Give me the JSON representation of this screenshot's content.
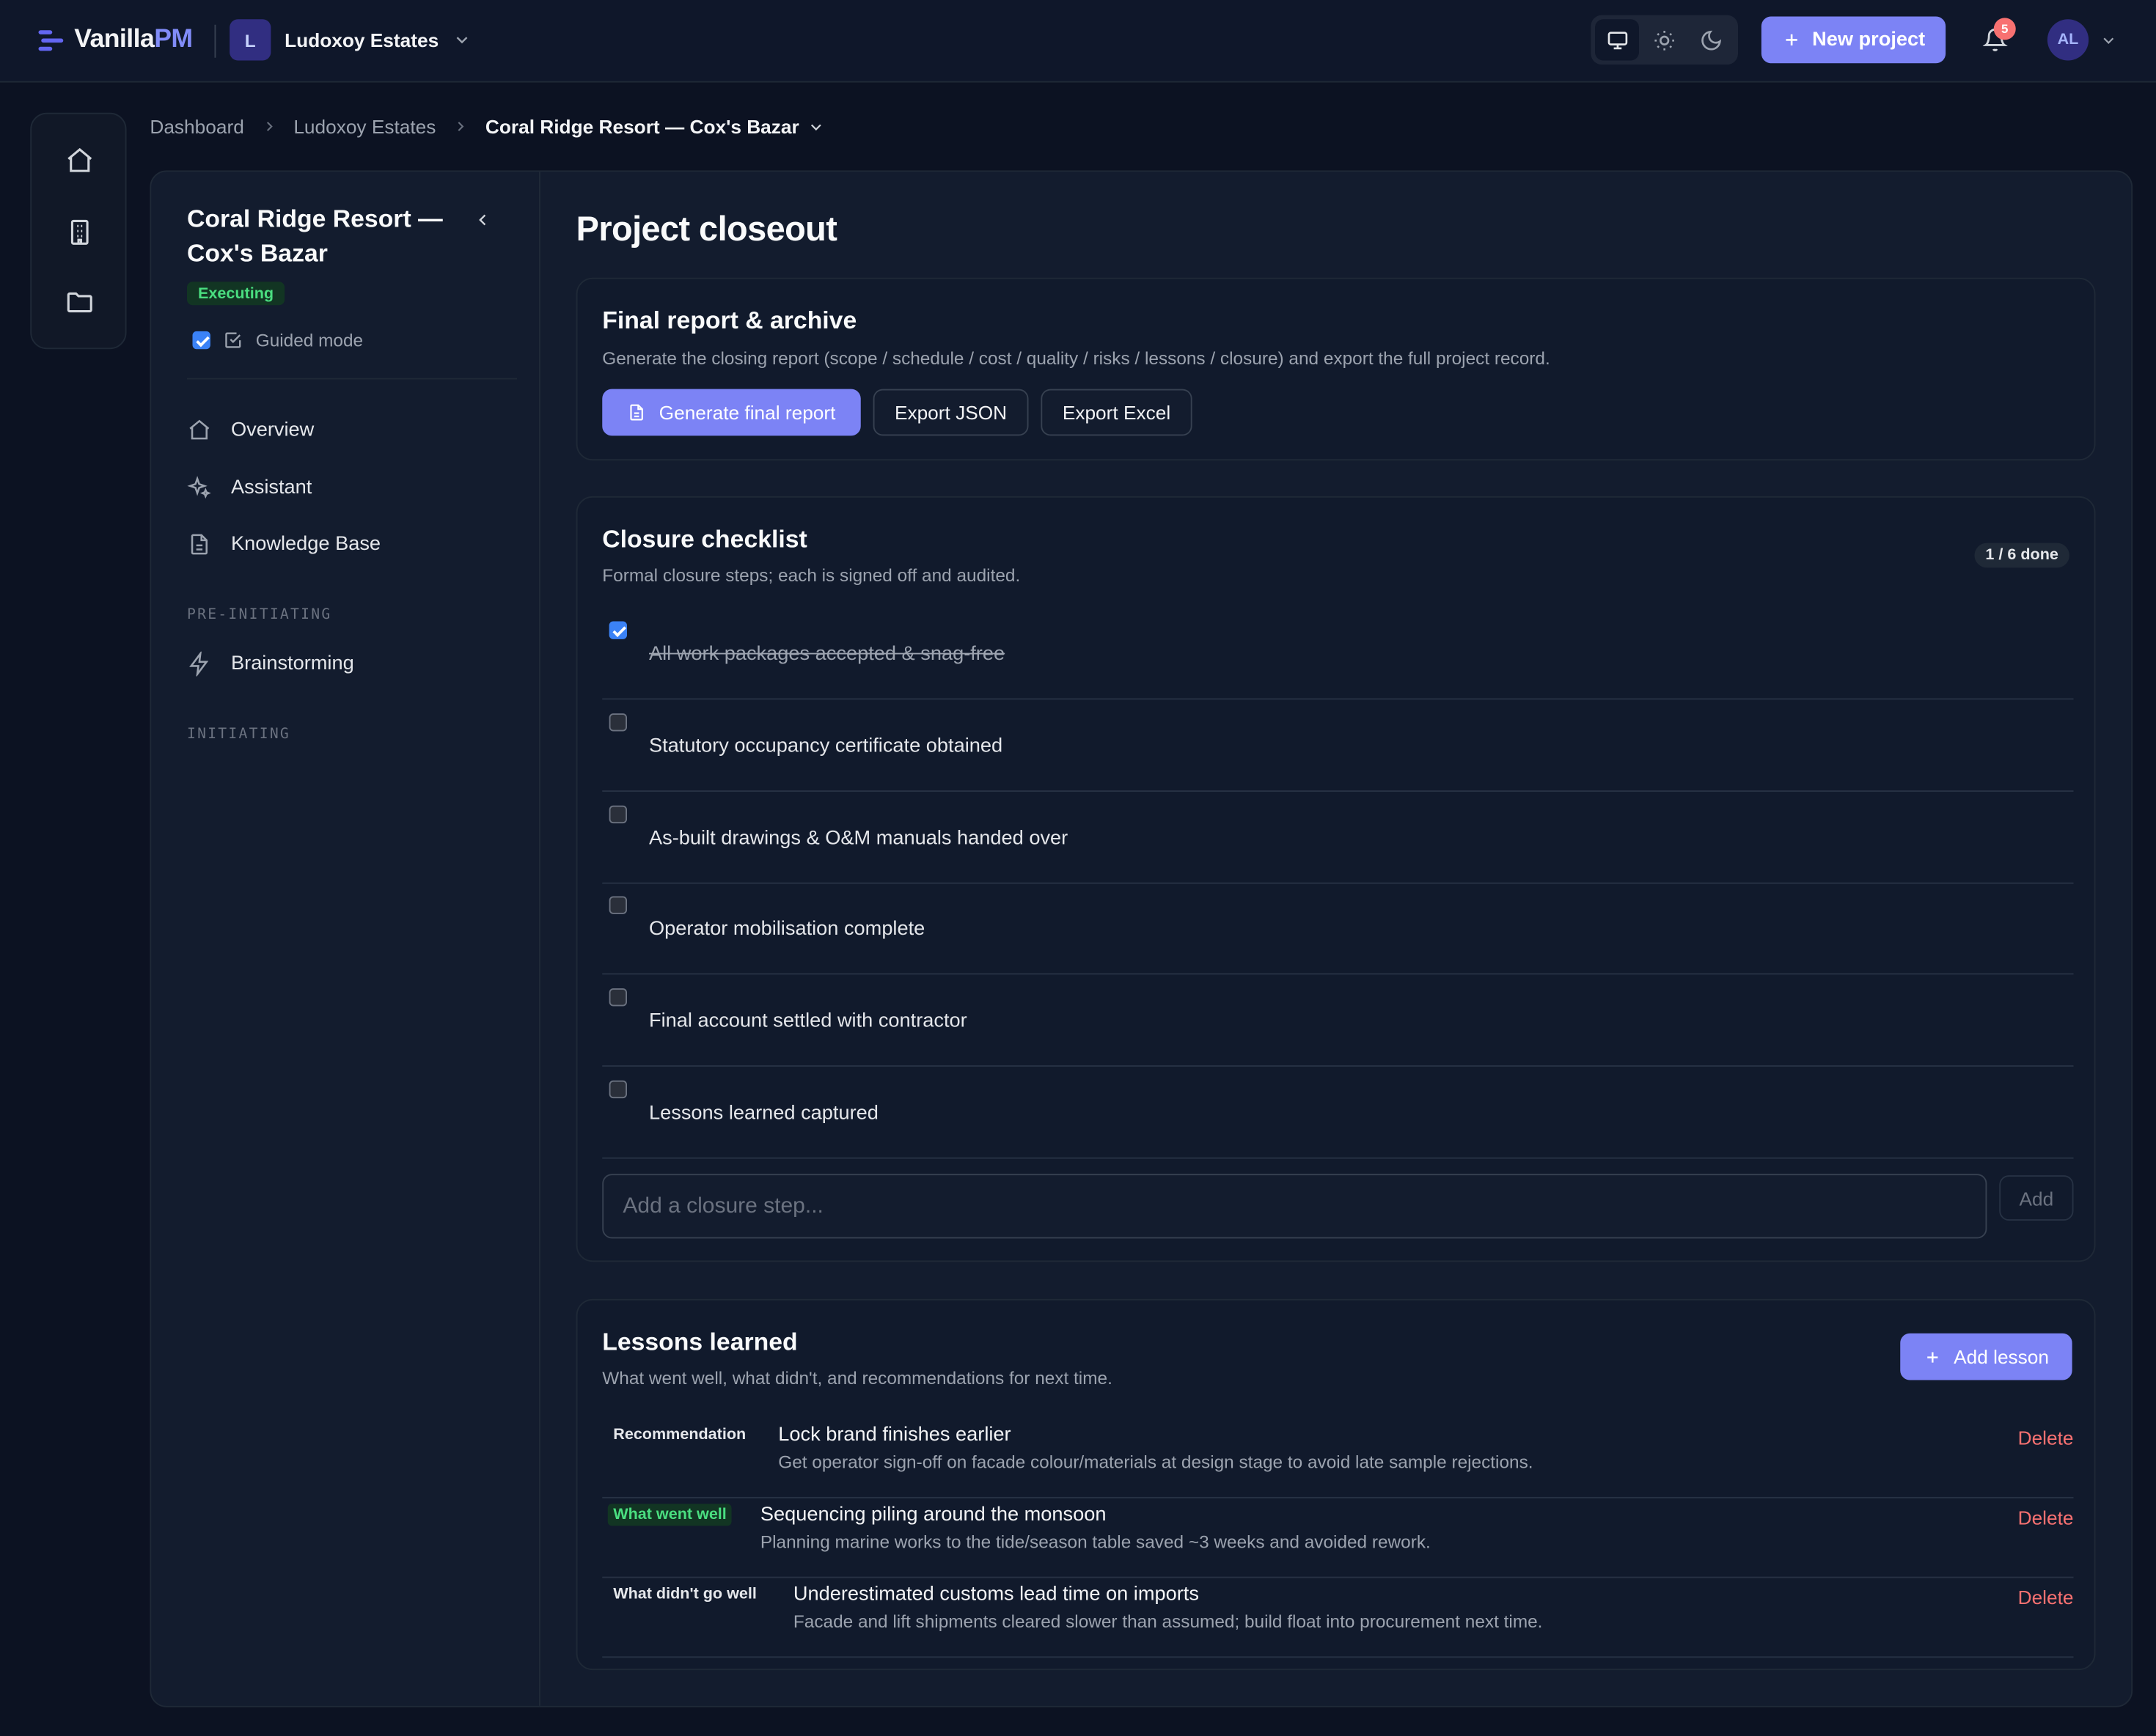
{
  "app": {
    "brand_main": "Vanilla",
    "brand_accent": "PM"
  },
  "org": {
    "initial": "L",
    "name": "Ludoxoy Estates"
  },
  "topbar": {
    "new_project_label": "New project",
    "notification_count": "5",
    "user_initials": "AL"
  },
  "breadcrumb": {
    "items": [
      "Dashboard",
      "Ludoxoy Estates"
    ],
    "current": "Coral Ridge Resort — Cox's Bazar"
  },
  "sidebar": {
    "project_title": "Coral Ridge Resort — Cox's Bazar",
    "status": "Executing",
    "guided_mode_label": "Guided mode",
    "guided_mode_checked": true,
    "items": [
      {
        "label": "Overview",
        "icon": "home-icon"
      },
      {
        "label": "Assistant",
        "icon": "sparkles-icon"
      },
      {
        "label": "Knowledge Base",
        "icon": "document-icon"
      }
    ],
    "sections": [
      {
        "title": "PRE-INITIATING",
        "items": [
          {
            "label": "Brainstorming",
            "icon": "lightning-icon"
          }
        ]
      },
      {
        "title": "INITIATING",
        "items": []
      }
    ]
  },
  "main": {
    "page_title": "Project closeout",
    "final_report": {
      "title": "Final report & archive",
      "subtitle": "Generate the closing report (scope / schedule / cost / quality / risks / lessons / closure) and export the full project record.",
      "generate_label": "Generate final report",
      "export_json_label": "Export JSON",
      "export_excel_label": "Export Excel"
    },
    "checklist": {
      "title": "Closure checklist",
      "subtitle": "Formal closure steps; each is signed off and audited.",
      "done_label": "1 / 6 done",
      "items": [
        {
          "label": "All work packages accepted & snag-free",
          "checked": true
        },
        {
          "label": "Statutory occupancy certificate obtained",
          "checked": false
        },
        {
          "label": "As-built drawings & O&M manuals handed over",
          "checked": false
        },
        {
          "label": "Operator mobilisation complete",
          "checked": false
        },
        {
          "label": "Final account settled with contractor",
          "checked": false
        },
        {
          "label": "Lessons learned captured",
          "checked": false
        }
      ],
      "add_placeholder": "Add a closure step...",
      "add_label": "Add"
    },
    "lessons": {
      "title": "Lessons learned",
      "subtitle": "What went well, what didn't, and recommendations for next time.",
      "add_label": "Add lesson",
      "delete_label": "Delete",
      "items": [
        {
          "tag": "Recommendation",
          "title": "Lock brand finishes earlier",
          "desc": "Get operator sign-off on facade colour/materials at design stage to avoid late sample rejections."
        },
        {
          "tag": "What went well",
          "title": "Sequencing piling around the monsoon",
          "desc": "Planning marine works to the tide/season table saved ~3 weeks and avoided rework."
        },
        {
          "tag": "What didn't go well",
          "title": "Underestimated customs lead time on imports",
          "desc": "Facade and lift shipments cleared slower than assumed; build float into procurement next time."
        }
      ]
    }
  },
  "colors": {
    "accent": "#7c83f5",
    "brand": "#6366f1",
    "success": "#4ade80",
    "danger": "#f87171",
    "background": "#0c1222"
  }
}
